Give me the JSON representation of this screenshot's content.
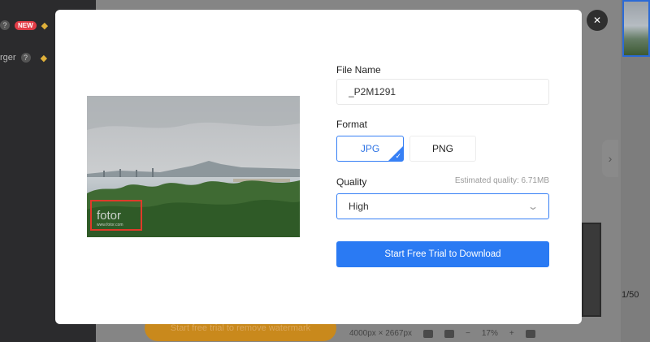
{
  "background": {
    "sidebar": {
      "row1_badge": "NEW",
      "row2_text": "rger"
    },
    "watermark_cta": "Start free trial to remove watermark",
    "dimensions": "4000px × 2667px",
    "zoom": "17%",
    "zoom_minus": "−",
    "zoom_plus": "+",
    "page_count": "1/50",
    "next_arrow": "›"
  },
  "modal": {
    "close_label": "✕",
    "file_name_label": "File Name",
    "file_name_value": "_P2M1291",
    "format_label": "Format",
    "formats": [
      {
        "label": "JPG",
        "selected": true
      },
      {
        "label": "PNG",
        "selected": false
      }
    ],
    "check_glyph": "✓",
    "quality_label": "Quality",
    "estimated_quality": "Estimated quality: 6.71MB",
    "quality_value": "High",
    "chevron_glyph": "⌄",
    "download_button": "Start Free Trial to Download",
    "preview_watermark": "fotor",
    "preview_watermark_sub": "www.fotor.com"
  },
  "colors": {
    "accent": "#2a7af3",
    "watermark_box": "#e03a2a"
  }
}
